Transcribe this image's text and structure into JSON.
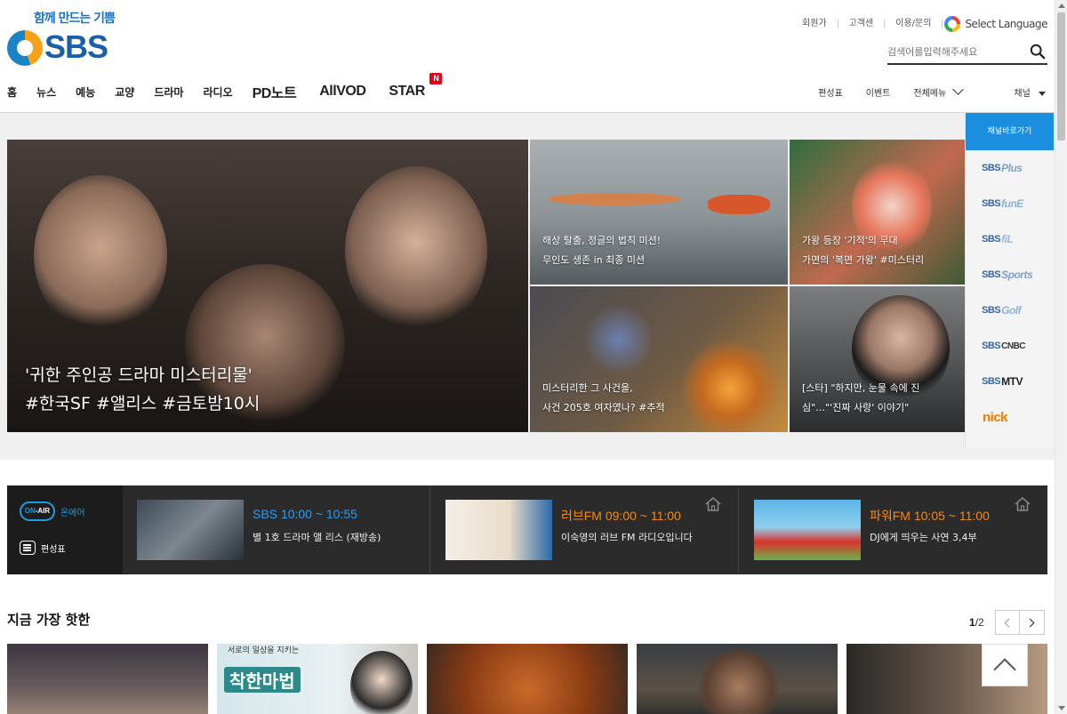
{
  "logo": {
    "slogan": "함께 만드는 기쁨",
    "word": "SBS"
  },
  "util": {
    "items": [
      "회원가",
      "고객센",
      "이용/문의"
    ],
    "language": "Select Language"
  },
  "search": {
    "placeholder": "검색어를입력해주세요"
  },
  "gnb": {
    "items": [
      "홈",
      "뉴스",
      "예능",
      "교양",
      "드라마",
      "라디오"
    ],
    "pd": "PD노트",
    "allvod": "AllVOD",
    "star": "STAR",
    "star_badge": "N"
  },
  "gnb_right": {
    "r1": "편성표",
    "r2": "이벤트",
    "r3": "전체메뉴",
    "r4": "채널"
  },
  "hero": {
    "main_caption_1": "'귀한 주인공 드라마 미스터리물'",
    "main_caption_2": "#한국SF #앨리스 #금토밤10시",
    "t2_caption_1": "해상 탈출, 정글의 법칙 미션!",
    "t2_caption_2": "무인도 생존 in 최종 미션",
    "t3_caption_1": "가왕 등장 '기적'의 무대",
    "t3_caption_2": "가면의 '복면 가왕' #미스터리",
    "t4_caption_1": "미스터리한 그 사건을,",
    "t4_caption_2": "사건 205호 여자였나? #추적",
    "t5_caption": "[스타] \"하지만, 눈물 속에 진심\"…\"'진짜 사랑' 이야기\""
  },
  "channels": {
    "head": "채널바로가기",
    "list": [
      {
        "sbs": "SBS",
        "sub": "Plus"
      },
      {
        "sbs": "SBS",
        "sub": "funE"
      },
      {
        "sbs": "SBS",
        "sub": "fiL"
      },
      {
        "sbs": "SBS",
        "sub": "Sports"
      },
      {
        "sbs": "SBS",
        "sub": "Golf"
      },
      {
        "sbs": "SBS",
        "sub": "CNBC"
      },
      {
        "sbs": "SBS",
        "sub": "MTV"
      },
      {
        "sbs": "",
        "sub": "nick"
      }
    ]
  },
  "onair": {
    "pill_on": "ON",
    "pill_air": "-AIR",
    "label": "온에어",
    "schedule": "편성표",
    "live": [
      {
        "time": "SBS 10:00 ~ 10:55",
        "title": "별 1호 드라마 앨 리스 (재방송)"
      },
      {
        "time": "러브FM 09:00 ~ 11:00",
        "title": "이숙영의 러브 FM 라디오입니다"
      },
      {
        "time": "파워FM 10:05 ~ 11:00",
        "title": "DJ에게 띄우는 사연 3,4부"
      }
    ]
  },
  "section": {
    "title": "지금 가장 핫한",
    "page_current": "1",
    "page_total": "/2"
  },
  "cards": {
    "c2_text1": "서로의 일상을 지키는",
    "c2_text2": "착한마법"
  },
  "colors": {
    "accent": "#1b8ee0",
    "onair_blue": "#2a9df4",
    "radio_orange": "#f28a1c",
    "badge_red": "#e3001b"
  }
}
